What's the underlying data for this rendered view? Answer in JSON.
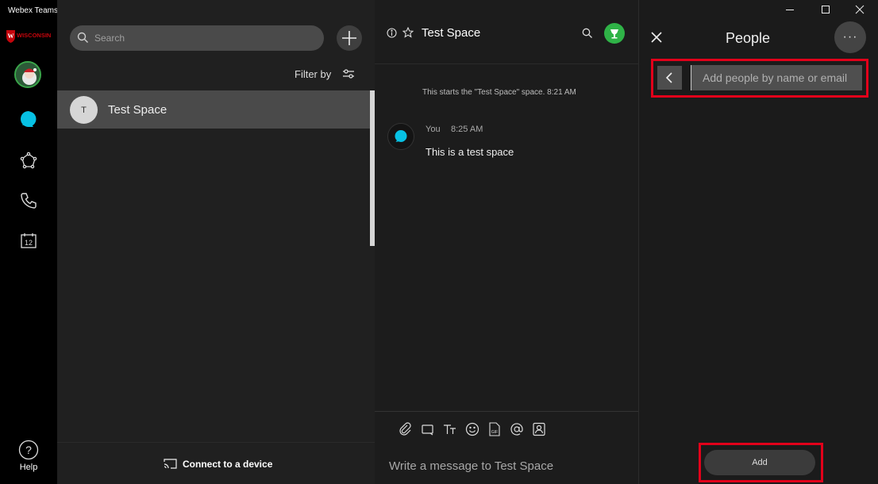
{
  "window": {
    "title": "Webex Teams",
    "controls": {
      "minimize": "minimize-icon",
      "maximize": "maximize-icon",
      "close": "close-icon"
    }
  },
  "rail": {
    "logo_text": "WISCONSIN",
    "icons": [
      "messaging-icon",
      "teams-icon",
      "calls-icon",
      "calendar-icon",
      "help-icon"
    ],
    "calendar_day": "12",
    "help_label": "Help",
    "active_color": "#07c1e4"
  },
  "spaces": {
    "search": {
      "placeholder": "Search"
    },
    "filter_label": "Filter by",
    "items": [
      {
        "initial": "T",
        "name": "Test Space"
      }
    ],
    "footer": {
      "connect_label": "Connect to a device"
    }
  },
  "conversation": {
    "title": "Test Space",
    "start_message": "This starts the \"Test Space\" space. 8:21 AM",
    "messages": [
      {
        "sender": "You",
        "time": "8:25 AM",
        "text": "This is a test space"
      }
    ],
    "composer": {
      "placeholder": "Write a message to Test Space",
      "tools": [
        "attach-icon",
        "whiteboard-icon",
        "format-text-icon",
        "emoji-icon",
        "gif-icon",
        "mention-icon",
        "contact-icon"
      ]
    }
  },
  "people_panel": {
    "title": "People",
    "more_label": "···",
    "input": {
      "placeholder": "Add people by name or email"
    },
    "add_button": "Add",
    "highlight_color": "#e2001a"
  }
}
